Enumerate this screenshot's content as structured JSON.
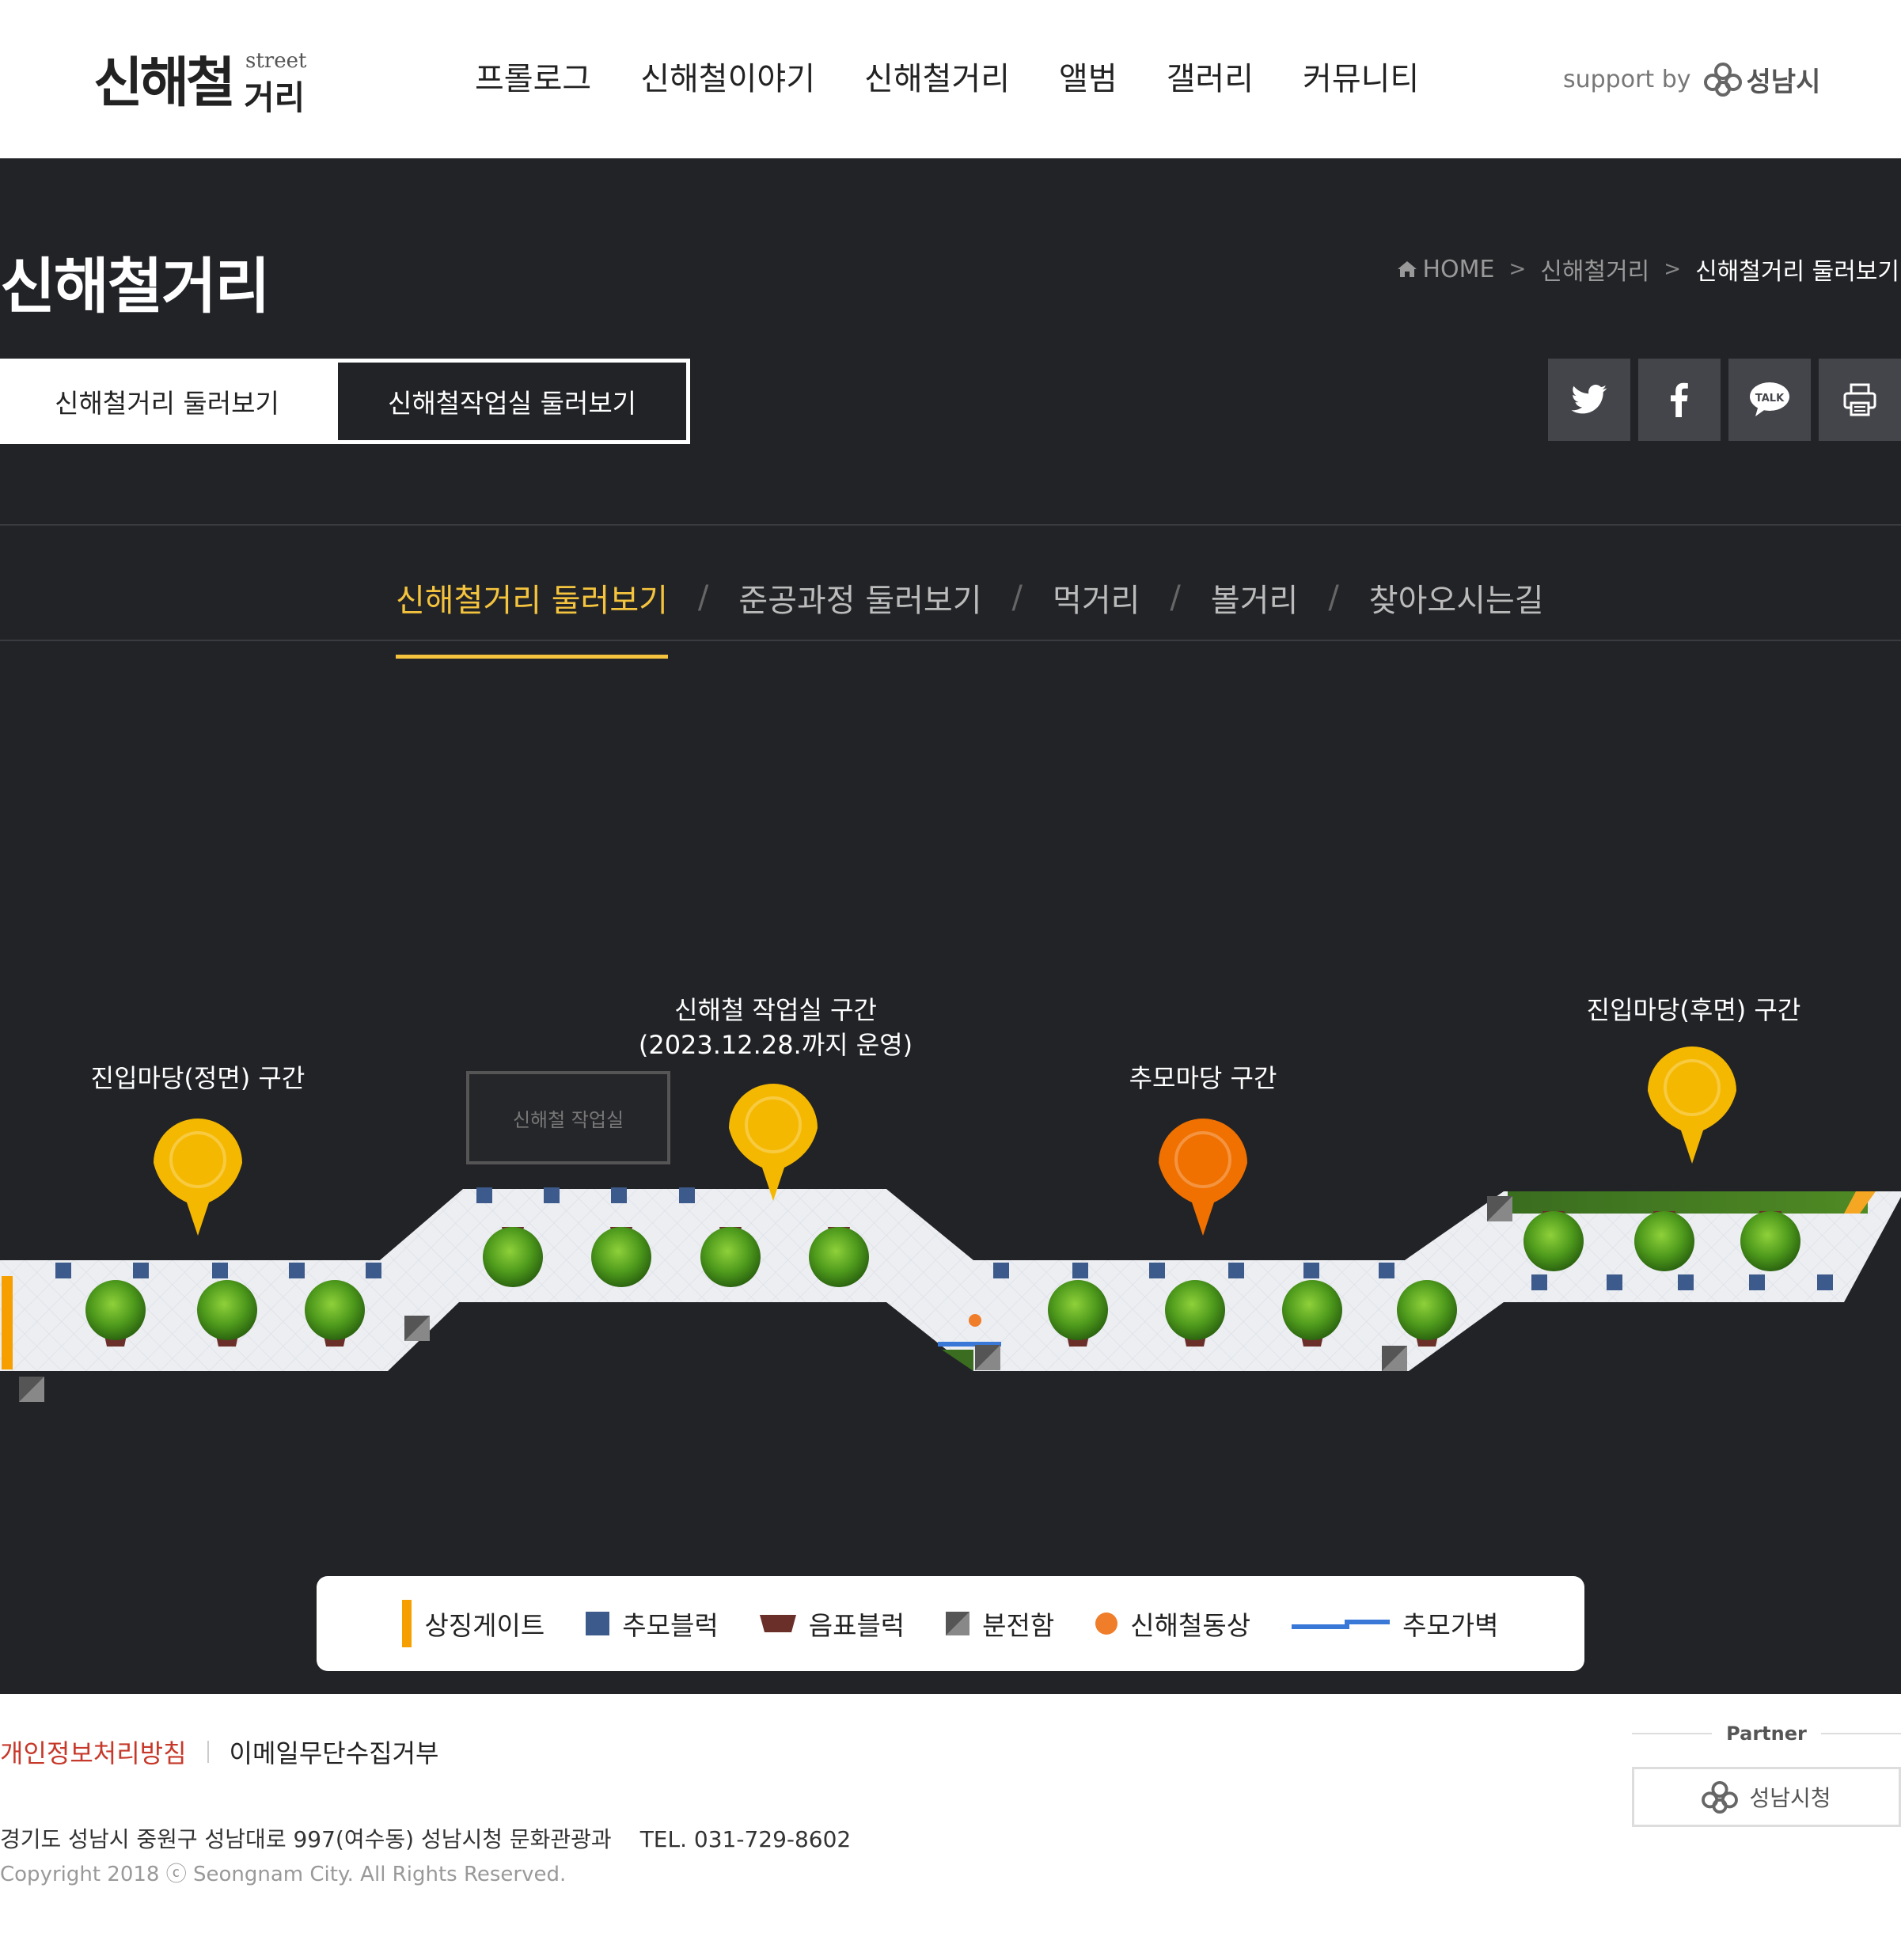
{
  "header": {
    "logo_main": "신해철",
    "logo_street": "street",
    "logo_geori": "거리",
    "nav": [
      "프롤로그",
      "신해철이야기",
      "신해철거리",
      "앨범",
      "갤러리",
      "커뮤니티"
    ],
    "support_label": "support by",
    "support_logo_text": "성남시"
  },
  "hero": {
    "title": "신해철거리",
    "breadcrumb": {
      "home": "HOME",
      "level1": "신해철거리",
      "current": "신해철거리 둘러보기"
    },
    "tabs": [
      "신해철거리 둘러보기",
      "신해철작업실 둘러보기"
    ],
    "share_icons": [
      "twitter-icon",
      "facebook-icon",
      "kakaotalk-icon",
      "print-icon"
    ],
    "share_talk_text": "TALK"
  },
  "subnav": {
    "items": [
      "신해철거리 둘러보기",
      "준공과정 둘러보기",
      "먹거리",
      "볼거리",
      "찾아오시는길"
    ],
    "separator": "/",
    "active_index": 0
  },
  "map": {
    "zones": [
      {
        "label": "진입마당(정면) 구간"
      },
      {
        "label": "신해철 작업실 구간",
        "note": "(2023.12.28.까지 운영)"
      },
      {
        "label": "추모마당 구간"
      },
      {
        "label": "진입마당(후면) 구간"
      }
    ],
    "workroom_label": "신해철 작업실"
  },
  "legend": {
    "items": [
      "상징게이트",
      "추모블럭",
      "음표블럭",
      "분전함",
      "신해철동상",
      "추모가벽"
    ]
  },
  "footer": {
    "links": [
      "개인정보처리방침",
      "이메일무단수집거부"
    ],
    "address": "경기도 성남시 중원구 성남대로 997(여수동) 성남시청 문화관광과",
    "tel": "TEL. 031-729-8602",
    "copyright": "Copyright 2018 ⓒ Seongnam City. All Rights Reserved.",
    "partner_title": "Partner",
    "partner_name": "성남시청"
  },
  "colors": {
    "dark_bg": "#222327",
    "accent": "#f5c43e",
    "pin_yellow": "#f5b800",
    "pin_orange": "#f07000",
    "block_blue": "#3d5a8c",
    "note_block": "#6b2f2a",
    "wall_blue": "#3a78d8",
    "link_red": "#c6392a"
  }
}
